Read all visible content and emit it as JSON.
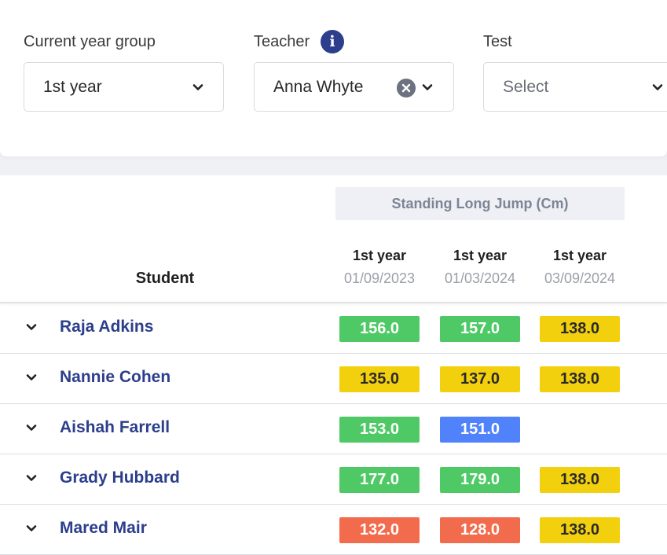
{
  "filters": {
    "year_group": {
      "label": "Current year group",
      "value": "1st year"
    },
    "teacher": {
      "label": "Teacher",
      "value": "Anna Whyte"
    },
    "test": {
      "label": "Test",
      "placeholder": "Select"
    }
  },
  "icons": {
    "info": "info-icon",
    "clear": "clear-icon",
    "dropdown": "chevron-down-icon",
    "expand": "chevron-down-icon"
  },
  "table": {
    "test_name": "Standing Long Jump (Cm)",
    "student_header": "Student",
    "columns": [
      {
        "year": "1st year",
        "date": "01/09/2023"
      },
      {
        "year": "1st year",
        "date": "01/03/2024"
      },
      {
        "year": "1st year",
        "date": "03/09/2024"
      }
    ],
    "rows": [
      {
        "name": "Raja Adkins",
        "scores": [
          {
            "value": "156.0",
            "level": "green"
          },
          {
            "value": "157.0",
            "level": "green"
          },
          {
            "value": "138.0",
            "level": "yellow"
          }
        ]
      },
      {
        "name": "Nannie Cohen",
        "scores": [
          {
            "value": "135.0",
            "level": "yellow"
          },
          {
            "value": "137.0",
            "level": "yellow"
          },
          {
            "value": "138.0",
            "level": "yellow"
          }
        ]
      },
      {
        "name": "Aishah Farrell",
        "scores": [
          {
            "value": "153.0",
            "level": "green"
          },
          {
            "value": "151.0",
            "level": "blue"
          },
          null
        ]
      },
      {
        "name": "Grady Hubbard",
        "scores": [
          {
            "value": "177.0",
            "level": "green"
          },
          {
            "value": "179.0",
            "level": "green"
          },
          {
            "value": "138.0",
            "level": "yellow"
          }
        ]
      },
      {
        "name": "Mared Mair",
        "scores": [
          {
            "value": "132.0",
            "level": "red"
          },
          {
            "value": "128.0",
            "level": "red"
          },
          {
            "value": "138.0",
            "level": "yellow"
          }
        ]
      }
    ]
  },
  "colors": {
    "green": "#4ec966",
    "yellow": "#f3d00e",
    "blue": "#4f82fb",
    "red": "#f26b4d",
    "accent": "#2c3e8c"
  }
}
